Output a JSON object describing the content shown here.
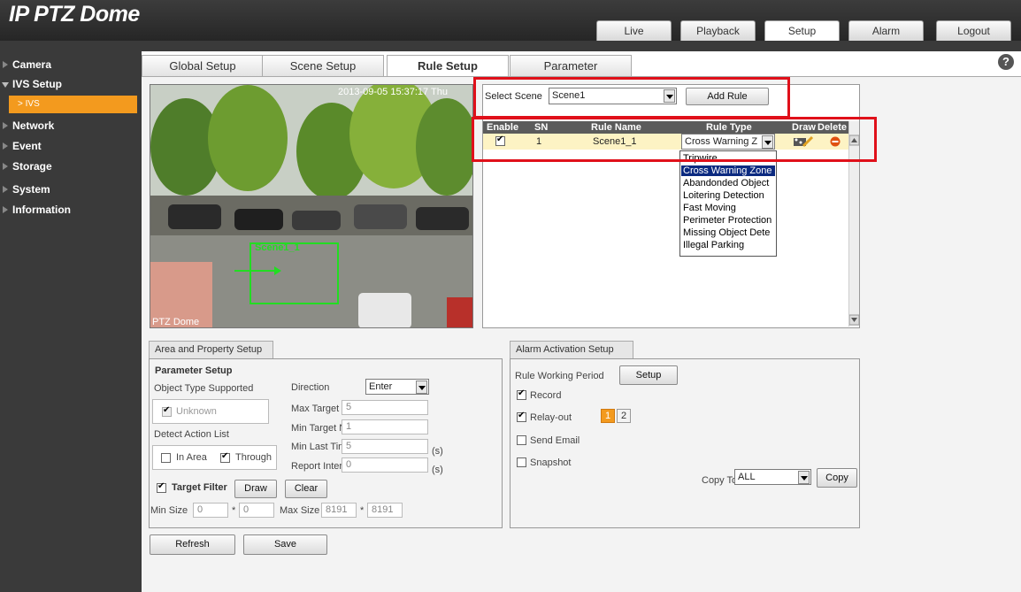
{
  "app": {
    "title": "IP PTZ Dome"
  },
  "nav": {
    "tabs": [
      "Live",
      "Playback",
      "Setup",
      "Alarm",
      "Logout"
    ],
    "active": "Setup"
  },
  "sidebar": {
    "items": [
      "Camera",
      "IVS Setup",
      "Network",
      "Event",
      "Storage",
      "System",
      "Information"
    ],
    "sub_item": "> IVS"
  },
  "subtabs": {
    "items": [
      "Global Setup",
      "Scene Setup",
      "Rule Setup",
      "Parameter"
    ],
    "active": "Rule Setup"
  },
  "help": {
    "glyph": "?"
  },
  "video": {
    "timestamp": "2013-09-05 15:37:17 Thu",
    "label": "PTZ Dome",
    "rule_label": "Scene1_1"
  },
  "rule_panel": {
    "select_scene_label": "Select Scene",
    "scene_value": "Scene1",
    "add_rule_label": "Add Rule",
    "headers": {
      "enable": "Enable",
      "sn": "SN",
      "rule_name": "Rule Name",
      "rule_type": "Rule Type",
      "draw": "Draw",
      "delete": "Delete"
    },
    "row": {
      "enabled": true,
      "sn": "1",
      "rule_name": "Scene1_1",
      "rule_type": "Cross Warning Z"
    },
    "rule_type_options": [
      "Tripwire",
      "Cross Warning Zone",
      "Abandonded Object",
      "Loitering Detection",
      "Fast Moving",
      "Perimeter Protection",
      "Missing Object Dete",
      "Illegal Parking"
    ],
    "selected_option": "Cross Warning Zone"
  },
  "area_setup": {
    "tab_label": "Area and Property Setup",
    "parameter_setup": "Parameter Setup",
    "object_type_label": "Object Type Supported",
    "unknown_label": "Unknown",
    "detect_action_label": "Detect Action List",
    "in_area_label": "In Area",
    "through_label": "Through",
    "in_area_checked": false,
    "through_checked": true,
    "target_filter_label": "Target Filter",
    "target_filter_checked": true,
    "draw_label": "Draw",
    "clear_label": "Clear",
    "min_size_label": "Min Size",
    "min_w": "0",
    "min_h": "0",
    "max_size_label": "Max Size",
    "max_w": "8191",
    "max_h": "8191",
    "size_sep": "*",
    "direction_label": "Direction",
    "direction_value": "Enter",
    "max_target_label": "Max Target No.",
    "max_target_value": "5",
    "min_target_label": "Min Target No.",
    "min_target_value": "1",
    "min_last_time_label": "Min Last Time",
    "min_last_time_value": "5",
    "report_interval_label": "Report Interval",
    "report_interval_value": "0",
    "unit_s": "(s)"
  },
  "alarm_setup": {
    "tab_label": "Alarm Activation Setup",
    "working_period_label": "Rule Working Period",
    "setup_label": "Setup",
    "record_label": "Record",
    "record_checked": true,
    "relay_label": "Relay-out",
    "relay_checked": true,
    "relay_channels": [
      "1",
      "2"
    ],
    "send_email_label": "Send Email",
    "send_email_checked": false,
    "snapshot_label": "Snapshot",
    "snapshot_checked": false,
    "copy_to_label": "Copy To",
    "copy_to_value": "ALL",
    "copy_label": "Copy"
  },
  "footer": {
    "refresh_label": "Refresh",
    "save_label": "Save"
  },
  "colors": {
    "accent": "#f39a1e",
    "highlight": "#e0101a",
    "selection": "#0b2a80"
  }
}
